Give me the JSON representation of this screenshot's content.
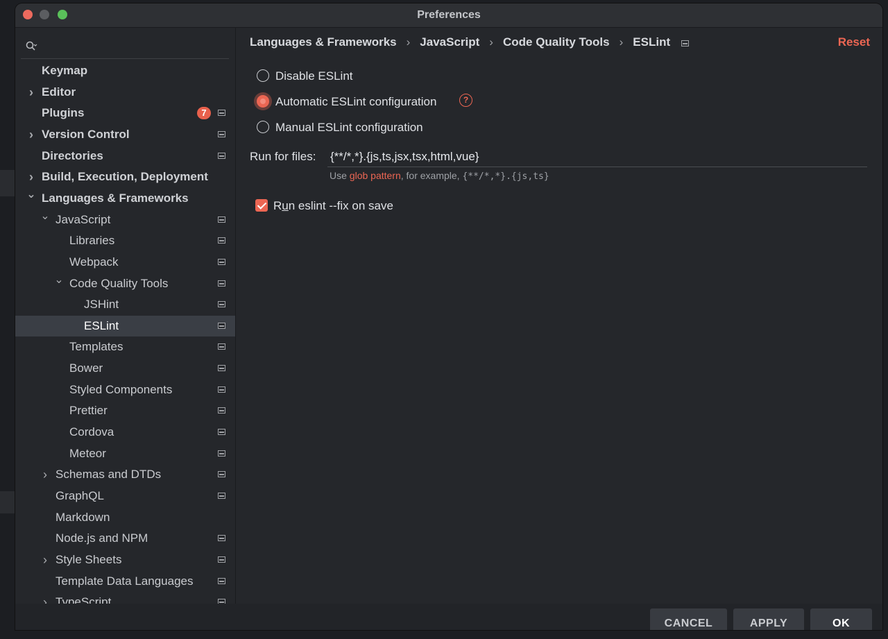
{
  "window": {
    "title": "Preferences"
  },
  "sidebar": {
    "search_placeholder": "",
    "items": [
      {
        "label": "Keymap",
        "bold": true,
        "level": 0,
        "expander": "",
        "icon": false
      },
      {
        "label": "Editor",
        "bold": true,
        "level": 0,
        "expander": "collapsed",
        "icon": false
      },
      {
        "label": "Plugins",
        "bold": true,
        "level": 0,
        "expander": "",
        "icon": true,
        "badge": "7"
      },
      {
        "label": "Version Control",
        "bold": true,
        "level": 0,
        "expander": "collapsed",
        "icon": true
      },
      {
        "label": "Directories",
        "bold": true,
        "level": 0,
        "expander": "",
        "icon": true
      },
      {
        "label": "Build, Execution, Deployment",
        "bold": true,
        "level": 0,
        "expander": "collapsed",
        "icon": false
      },
      {
        "label": "Languages & Frameworks",
        "bold": true,
        "level": 0,
        "expander": "expanded",
        "icon": false
      },
      {
        "label": "JavaScript",
        "bold": false,
        "level": 1,
        "expander": "expanded",
        "icon": true
      },
      {
        "label": "Libraries",
        "bold": false,
        "level": 2,
        "expander": "",
        "icon": true
      },
      {
        "label": "Webpack",
        "bold": false,
        "level": 2,
        "expander": "",
        "icon": true
      },
      {
        "label": "Code Quality Tools",
        "bold": false,
        "level": 2,
        "expander": "expanded",
        "icon": true
      },
      {
        "label": "JSHint",
        "bold": false,
        "level": 3,
        "expander": "",
        "icon": true
      },
      {
        "label": "ESLint",
        "bold": false,
        "level": 3,
        "expander": "",
        "icon": true,
        "selected": true
      },
      {
        "label": "Templates",
        "bold": false,
        "level": 2,
        "expander": "",
        "icon": true
      },
      {
        "label": "Bower",
        "bold": false,
        "level": 2,
        "expander": "",
        "icon": true
      },
      {
        "label": "Styled Components",
        "bold": false,
        "level": 2,
        "expander": "",
        "icon": true
      },
      {
        "label": "Prettier",
        "bold": false,
        "level": 2,
        "expander": "",
        "icon": true
      },
      {
        "label": "Cordova",
        "bold": false,
        "level": 2,
        "expander": "",
        "icon": true
      },
      {
        "label": "Meteor",
        "bold": false,
        "level": 2,
        "expander": "",
        "icon": true
      },
      {
        "label": "Schemas and DTDs",
        "bold": false,
        "level": 1,
        "expander": "collapsed",
        "icon": true
      },
      {
        "label": "GraphQL",
        "bold": false,
        "level": 1,
        "expander": "",
        "icon": true
      },
      {
        "label": "Markdown",
        "bold": false,
        "level": 1,
        "expander": "",
        "icon": false
      },
      {
        "label": "Node.js and NPM",
        "bold": false,
        "level": 1,
        "expander": "",
        "icon": true
      },
      {
        "label": "Style Sheets",
        "bold": false,
        "level": 1,
        "expander": "collapsed",
        "icon": true
      },
      {
        "label": "Template Data Languages",
        "bold": false,
        "level": 1,
        "expander": "",
        "icon": true
      },
      {
        "label": "TypeScript",
        "bold": false,
        "level": 1,
        "expander": "collapsed",
        "icon": true
      }
    ]
  },
  "breadcrumb": [
    "Languages & Frameworks",
    "JavaScript",
    "Code Quality Tools",
    "ESLint"
  ],
  "reset_label": "Reset",
  "options": {
    "disable": "Disable ESLint",
    "automatic": "Automatic ESLint configuration",
    "manual": "Manual ESLint configuration",
    "selected": "automatic"
  },
  "run_for_files": {
    "label": "Run for files:",
    "value": "{**/*,*}.{js,ts,jsx,tsx,html,vue}",
    "hint_prefix": "Use ",
    "hint_link": "glob pattern",
    "hint_middle": ", for example, ",
    "hint_example": "{**/*,*}.{js,ts}"
  },
  "fix_on_save": {
    "label_pre": "R",
    "label_underlined": "u",
    "label_post": "n eslint --fix on save",
    "checked": true
  },
  "buttons": {
    "cancel": "CANCEL",
    "apply": "APPLY",
    "ok": "OK"
  },
  "colors": {
    "accent": "#ec6653",
    "background": "#25272b",
    "selection": "#3a3e45"
  },
  "icons": [
    "search-icon",
    "chevron-right-icon",
    "chevron-down-icon",
    "project-level-icon",
    "help-icon"
  ]
}
